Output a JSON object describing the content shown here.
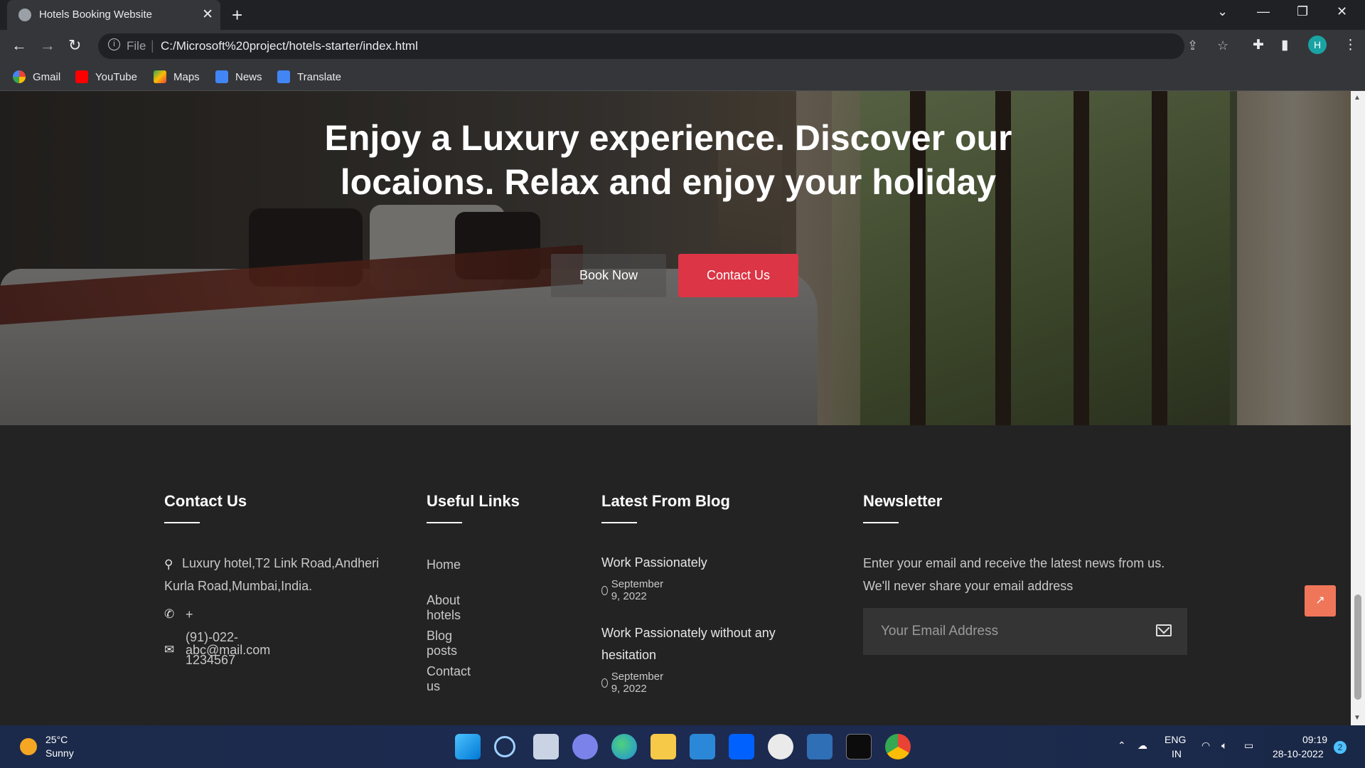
{
  "browser": {
    "tab_title": "Hotels Booking Website",
    "close_glyph": "✕",
    "new_tab_glyph": "+",
    "scheme_label": "File",
    "url": "C:/Microsoft%20project/hotels-starter/index.html",
    "profile_initial": "H",
    "bookmarks": [
      {
        "label": "Gmail",
        "color": "#ea4335"
      },
      {
        "label": "YouTube",
        "color": "#ff0000"
      },
      {
        "label": "Maps",
        "color": "#34a853"
      },
      {
        "label": "News",
        "color": "#4285f4"
      },
      {
        "label": "Translate",
        "color": "#4285f4"
      }
    ]
  },
  "hero": {
    "heading": "Enjoy a Luxury experience. Discover our locaions. Relax and enjoy your holiday",
    "book_label": "Book Now",
    "contact_label": "Contact Us"
  },
  "footer": {
    "contact": {
      "title": "Contact Us",
      "address": "Luxury hotel,T2 Link Road,Andheri Kurla Road,Mumbai,India.",
      "phone": "+(91)-022-1234567",
      "email": "abc@mail.com"
    },
    "links": {
      "title": "Useful Links",
      "items": [
        "Home",
        "About hotels",
        "Blog posts",
        "Contact us"
      ]
    },
    "blog": {
      "title": "Latest From Blog",
      "posts": [
        {
          "title": "Work Passionately",
          "date": "September 9, 2022"
        },
        {
          "title": "Work Passionately without any hesitation",
          "date": "September 9, 2022"
        }
      ]
    },
    "newsletter": {
      "title": "Newsletter",
      "text": "Enter your email and receive the latest news from us. We'll never share your email address",
      "placeholder": "Your Email Address"
    }
  },
  "taskbar": {
    "temp": "25°C",
    "weather": "Sunny",
    "lang1": "ENG",
    "lang2": "IN",
    "time": "09:19",
    "date": "28-10-2022",
    "notifications": "2"
  },
  "colors": {
    "accent_red": "#dc3545",
    "back_to_top": "#f0765a",
    "footer_bg": "#232323"
  }
}
